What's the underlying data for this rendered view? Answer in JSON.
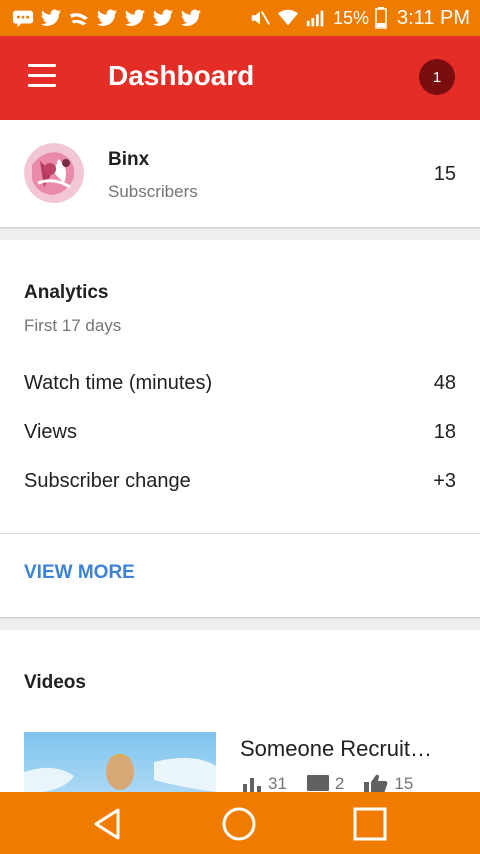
{
  "status_bar": {
    "battery_percent": "15%",
    "time": "3:11 PM",
    "icons": [
      "message-icon",
      "twitter-icon",
      "slack-icon",
      "twitter-icon",
      "twitter-icon",
      "twitter-icon",
      "twitter-icon",
      "mute-icon",
      "wifi-icon",
      "signal-icon",
      "battery-icon"
    ]
  },
  "app_bar": {
    "title": "Dashboard",
    "notification_count": "1"
  },
  "channel": {
    "name": "Binx",
    "subscribers_label": "Subscribers",
    "subscribers_count": "15"
  },
  "analytics": {
    "title": "Analytics",
    "period": "First 17 days",
    "metrics": [
      {
        "label": "Watch time (minutes)",
        "value": "48"
      },
      {
        "label": "Views",
        "value": "18"
      },
      {
        "label": "Subscriber change",
        "value": "+3"
      }
    ],
    "view_more_label": "VIEW MORE"
  },
  "videos": {
    "title": "Videos",
    "items": [
      {
        "title": "Someone Recruit…",
        "views": "31",
        "comments": "2",
        "likes": "15"
      }
    ]
  },
  "colors": {
    "status_bar": "#ef7c00",
    "app_bar": "#e52d27",
    "badge": "#7a0d0d",
    "link": "#3e82d6",
    "nav_bar": "#ef7c00"
  }
}
